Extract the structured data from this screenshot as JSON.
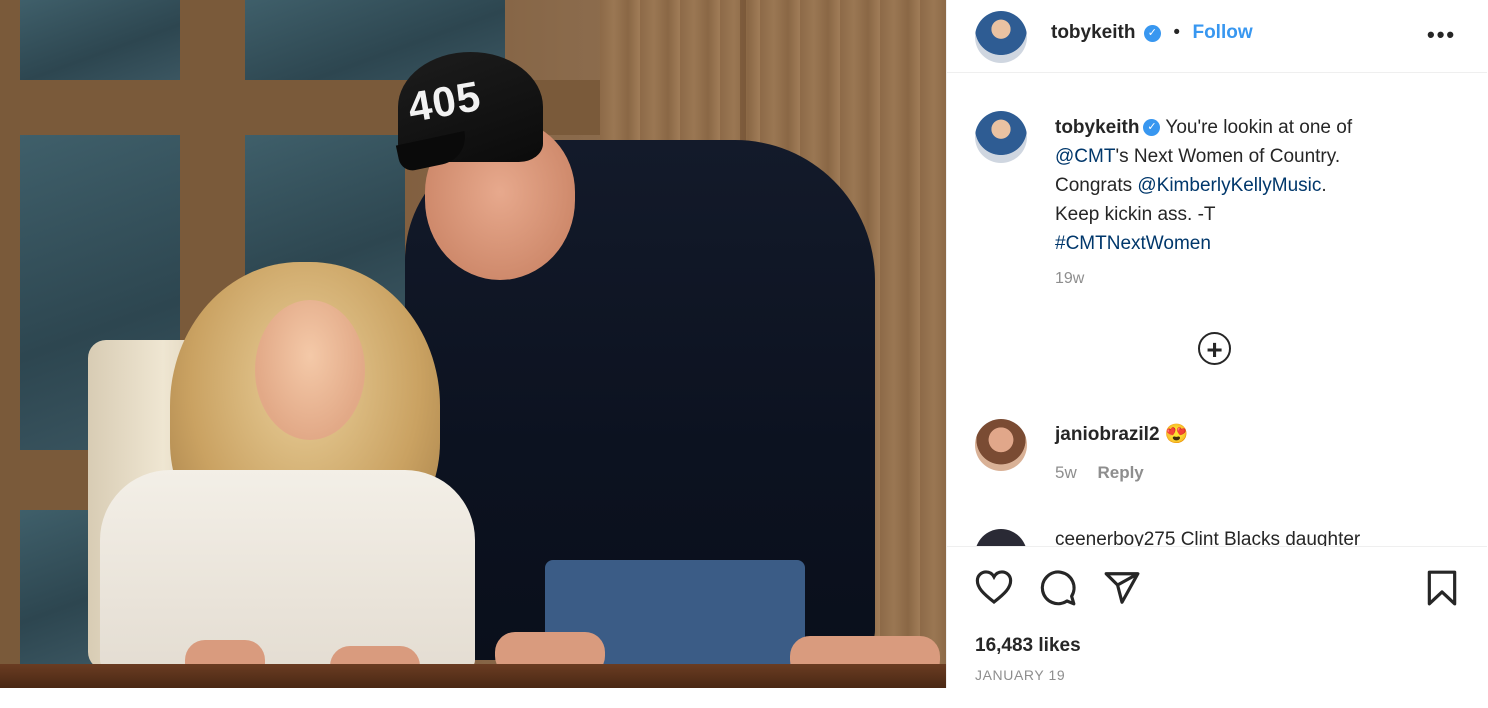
{
  "photo": {
    "cap_text": "405"
  },
  "header": {
    "username": "tobykeith",
    "separator": "•",
    "follow_label": "Follow",
    "more_label": "•••"
  },
  "caption": {
    "username": "tobykeith",
    "text_1": "You're lookin at one of",
    "mention_1": "@CMT",
    "text_2": "'s Next Women of Country.",
    "text_3": "Congrats ",
    "mention_2": "@KimberlyKellyMusic",
    "text_4": ".",
    "text_5": "Keep kickin ass. -T",
    "hashtag": "#CMTNextWomen",
    "time": "19w"
  },
  "comments": [
    {
      "username": "janiobrazil2",
      "text": "😍",
      "time": "5w",
      "reply_label": "Reply"
    },
    {
      "username": "",
      "text": "ceenerboy275 Clint Blacks daughter"
    }
  ],
  "icons": {
    "verified": "✓",
    "add_comment": "+",
    "like": "heart-icon",
    "comment": "speech-bubble-icon",
    "share": "paper-plane-icon",
    "save": "bookmark-icon"
  },
  "footer": {
    "likes": "16,483 likes",
    "date": "JANUARY 19"
  },
  "colors": {
    "accent": "#3897f0",
    "link": "#00376b",
    "muted": "#8e8e8e",
    "text": "#262626"
  }
}
